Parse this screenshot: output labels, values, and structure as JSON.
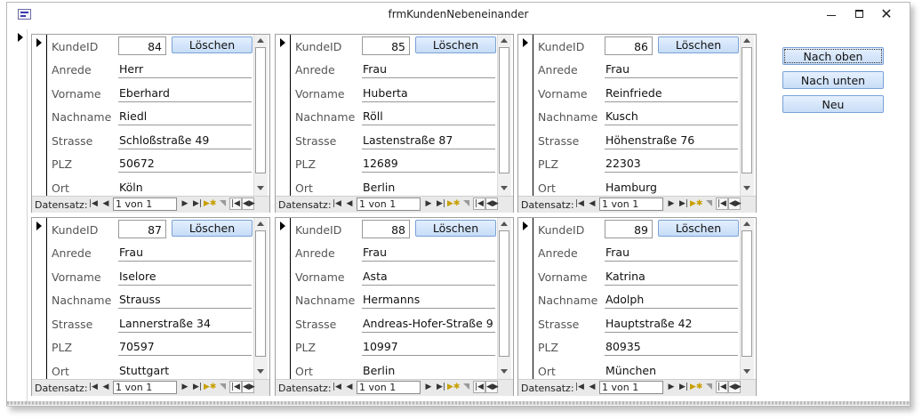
{
  "window": {
    "title": "frmKundenNebeneinander",
    "minimize_glyph": "",
    "maximize_glyph": "",
    "close_glyph": "✕"
  },
  "labels": {
    "kundeid": "KundeID",
    "anrede": "Anrede",
    "vorname": "Vorname",
    "nachname": "Nachname",
    "strasse": "Strasse",
    "plz": "PLZ",
    "ort": "Ort",
    "loeschen": "Löschen",
    "datensatz": "Datensatz:"
  },
  "navigation": {
    "position": "1 von 1",
    "icons": [
      "first-record-icon",
      "prev-record-icon",
      "next-record-icon",
      "last-record-icon",
      "new-record-icon"
    ]
  },
  "buttons": {
    "nach_oben": "Nach oben",
    "nach_unten": "Nach unten",
    "neu": "Neu"
  },
  "records": [
    {
      "kundeid": "84",
      "anrede": "Herr",
      "vorname": "Eberhard",
      "nachname": "Riedl",
      "strasse": "Schloßstraße 49",
      "plz": "50672",
      "ort": "Köln"
    },
    {
      "kundeid": "85",
      "anrede": "Frau",
      "vorname": "Huberta",
      "nachname": "Röll",
      "strasse": "Lastenstraße 87",
      "plz": "12689",
      "ort": "Berlin"
    },
    {
      "kundeid": "86",
      "anrede": "Frau",
      "vorname": "Reinfriede",
      "nachname": "Kusch",
      "strasse": "Höhenstraße 76",
      "plz": "22303",
      "ort": "Hamburg"
    },
    {
      "kundeid": "87",
      "anrede": "Frau",
      "vorname": "Iselore",
      "nachname": "Strauss",
      "strasse": "Lannerstraße 34",
      "plz": "70597",
      "ort": "Stuttgart"
    },
    {
      "kundeid": "88",
      "anrede": "Frau",
      "vorname": "Asta",
      "nachname": "Hermanns",
      "strasse": "Andreas-Hofer-Straße 9",
      "plz": "10997",
      "ort": "Berlin"
    },
    {
      "kundeid": "89",
      "anrede": "Frau",
      "vorname": "Katrina",
      "nachname": "Adolph",
      "strasse": "Hauptstraße 42",
      "plz": "80935",
      "ort": "München"
    }
  ]
}
